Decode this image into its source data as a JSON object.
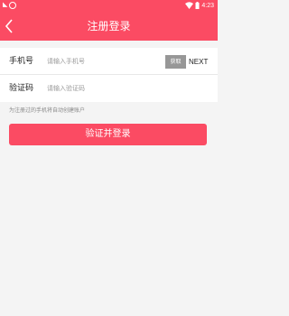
{
  "status_bar": {
    "time": "4:23",
    "left_icons": [
      "notification-icon",
      "app-icon"
    ],
    "right_icons": [
      "wifi-icon",
      "battery-icon"
    ]
  },
  "app_bar": {
    "title": "注册登录",
    "back_icon": "back-arrow-icon"
  },
  "form": {
    "phone": {
      "label": "手机号",
      "placeholder": "请输入手机号",
      "value": ""
    },
    "code": {
      "label": "验证码",
      "placeholder": "请输入验证码",
      "value": ""
    },
    "get_code_label": "获取",
    "next_label": "NEXT"
  },
  "hint": "为注册过的手机将自动创建账户",
  "submit_label": "验证并登录",
  "colors": {
    "accent": "#fb4b63",
    "background": "#f4f4f4",
    "get_code_bg": "#979797"
  }
}
